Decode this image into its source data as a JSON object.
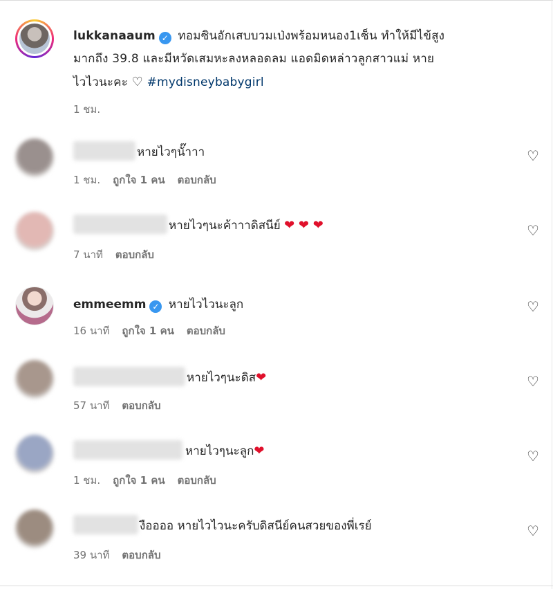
{
  "caption": {
    "username": "lukkanaaum",
    "line1": "ทอมซินอักเสบบวมเป่งพร้อมหนอง1เซ็น ทำให้มีไข้สูง",
    "line2": "มากถึง 39.8 และมีหวัดเสมหะลงหลอดลม แอดมิดหล่าวลูกสาวแม่ หาย",
    "line3_prefix": "ไวไวนะคะ",
    "line3_emoji": "♡",
    "hashtag": "#mydisneybabygirl",
    "time": "1 ชม."
  },
  "comments": [
    {
      "text": "หายไวๆนั๊าาา",
      "time": "1 ชม.",
      "likes": "ถูกใจ 1 คน",
      "reply": "ตอบกลับ",
      "hearts": 0,
      "avatar_color": "#9a908e"
    },
    {
      "text": "หายไวๆนะค้าาาดิสนีย์",
      "time": "7 นาที",
      "likes": "",
      "reply": "ตอบกลับ",
      "hearts": 3,
      "avatar_color": "#e2b8b4"
    },
    {
      "username": "emmeemm",
      "text": "หายไวไวนะลูก",
      "time": "16 นาที",
      "likes": "ถูกใจ 1 คน",
      "reply": "ตอบกลับ"
    },
    {
      "text": "หายไวๆนะดิส",
      "time": "57 นาที",
      "likes": "",
      "reply": "ตอบกลับ",
      "hearts": 1,
      "avatar_color": "#a8978d"
    },
    {
      "text": "หายไวๆนะลูก",
      "time": "1 ชม.",
      "likes": "ถูกใจ 1 คน",
      "reply": "ตอบกลับ",
      "hearts": 1,
      "avatar_color": "#9aa6c4"
    },
    {
      "text": "งืออออ หายไวไวนะครับดิสนีย์คนสวยของพี่เรย์",
      "time": "39 นาที",
      "likes": "",
      "reply": "ตอบกลับ",
      "hearts": 0,
      "avatar_color": "#9c8c80"
    }
  ],
  "icons": {
    "heart_outline": "♡",
    "red_heart": "❤",
    "verified": "✓"
  },
  "colors": {
    "accent": "#3897f0",
    "hashtag": "#00376b",
    "meta": "#737373",
    "red_heart": "#e0102b"
  }
}
